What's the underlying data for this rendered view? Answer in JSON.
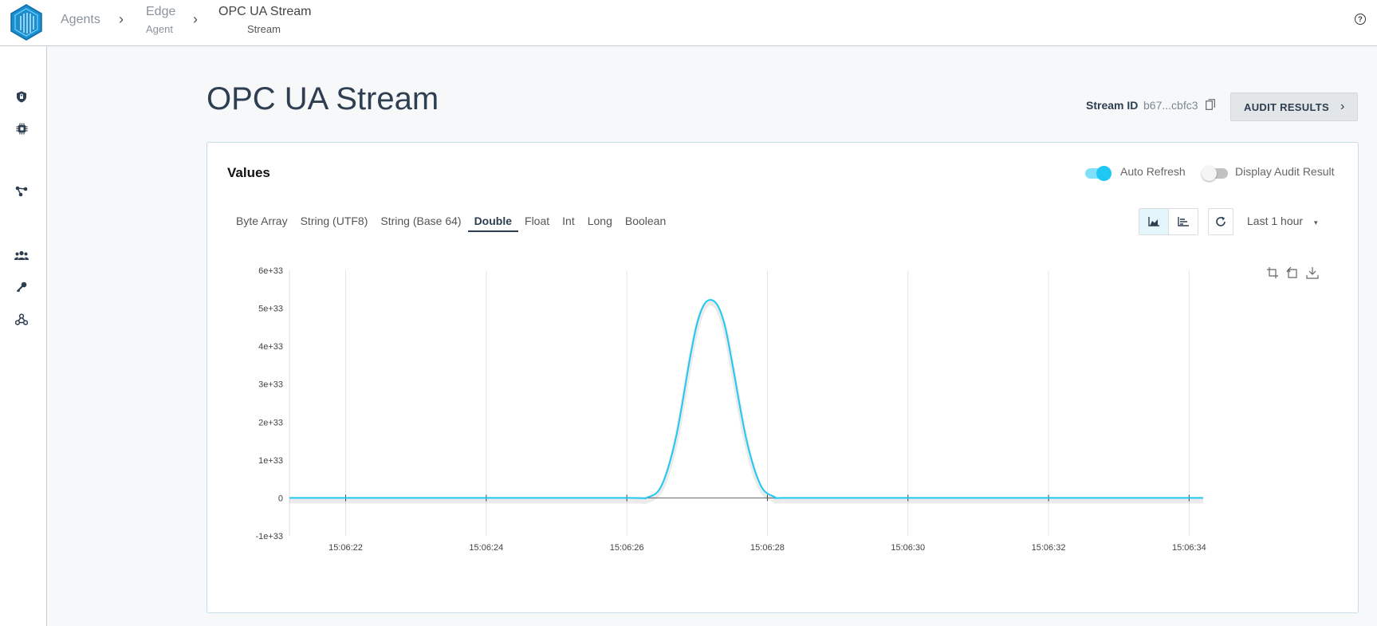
{
  "breadcrumb": {
    "items": [
      {
        "label": "Agents",
        "sub": ""
      },
      {
        "label": "Edge",
        "sub": "Agent"
      },
      {
        "label": "OPC UA Stream",
        "sub": "Stream"
      }
    ]
  },
  "header": {
    "help_icon": "?"
  },
  "sidebar": {
    "icons": [
      "shield-lock-icon",
      "chip-icon",
      "network-icon",
      "users-icon",
      "key-icon",
      "webhook-icon"
    ]
  },
  "page": {
    "title": "OPC UA Stream",
    "stream_id_label": "Stream ID",
    "stream_id_value": "b67...cbfc3",
    "audit_button": "AUDIT RESULTS"
  },
  "card": {
    "title": "Values",
    "auto_refresh_label": "Auto Refresh",
    "auto_refresh_on": true,
    "display_audit_label": "Display Audit Result",
    "display_audit_on": false,
    "tabs": [
      "Byte Array",
      "String (UTF8)",
      "String (Base 64)",
      "Double",
      "Float",
      "Int",
      "Long",
      "Boolean"
    ],
    "active_tab": "Double",
    "time_range": "Last 1 hour",
    "accent_color": "#1ec8f2"
  },
  "chart_data": {
    "type": "line",
    "title": "",
    "xlabel": "",
    "ylabel": "",
    "y_ticks": [
      "6e+33",
      "5e+33",
      "4e+33",
      "3e+33",
      "2e+33",
      "1e+33",
      "0",
      "-1e+33"
    ],
    "ylim": [
      -1e+33,
      6e+33
    ],
    "x_ticks": [
      "15:06:22",
      "15:06:24",
      "15:06:26",
      "15:06:28",
      "15:06:30",
      "15:06:32",
      "15:06:34"
    ],
    "xlim_seconds": [
      21.2,
      34.2
    ],
    "series": [
      {
        "color": "#1ec8f2",
        "x": [
          "15:06:21.2",
          "15:06:24",
          "15:06:26",
          "15:06:26.3",
          "15:06:26.5",
          "15:06:26.7",
          "15:06:26.9",
          "15:06:27.0",
          "15:06:27.1",
          "15:06:27.2",
          "15:06:27.3",
          "15:06:27.4",
          "15:06:27.5",
          "15:06:27.7",
          "15:06:27.9",
          "15:06:28.1",
          "15:06:28.3",
          "15:06:30",
          "15:06:34.2"
        ],
        "y": [
          0,
          0,
          0,
          2e+31,
          3.5e+32,
          1.6e+33,
          3.7e+33,
          4.6e+33,
          5.1e+33,
          5.22e+33,
          5.05e+33,
          4.5e+33,
          3.55e+33,
          1.55e+33,
          3.5e+32,
          3e+31,
          0,
          0,
          0
        ]
      }
    ],
    "grid": true
  }
}
